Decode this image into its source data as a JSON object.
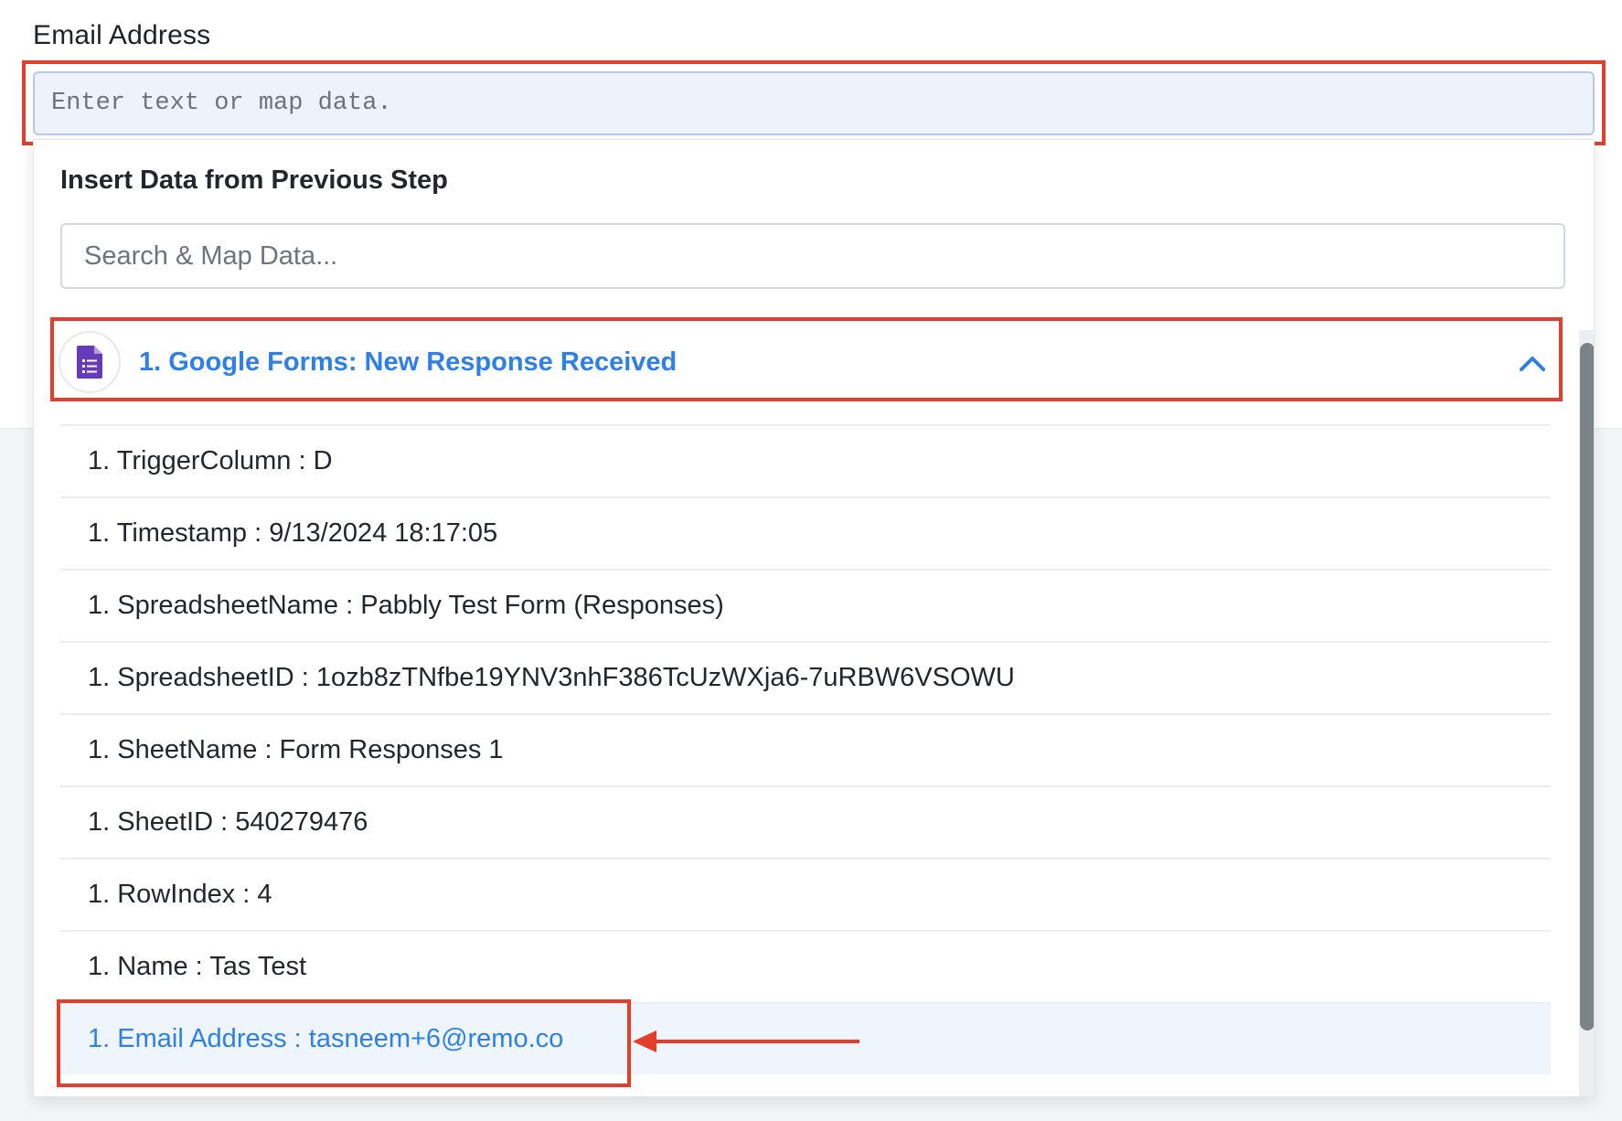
{
  "field": {
    "label": "Email Address",
    "placeholder": "Enter text or map data."
  },
  "dropdown": {
    "title": "Insert Data from Previous Step",
    "search_placeholder": "Search & Map Data...",
    "step": {
      "title": "1. Google Forms: New Response Received",
      "icon": "google-forms-icon",
      "expanded": true
    },
    "items": [
      {
        "label": "1. TriggerColumn : D"
      },
      {
        "label": "1. Timestamp : 9/13/2024 18:17:05"
      },
      {
        "label": "1. SpreadsheetName : Pabbly Test Form (Responses)"
      },
      {
        "label": "1. SpreadsheetID : 1ozb8zTNfbe19YNV3nhF386TcUzWXja6-7uRBW6VSOWU"
      },
      {
        "label": "1. SheetName : Form Responses 1"
      },
      {
        "label": "1. SheetID : 540279476"
      },
      {
        "label": "1. RowIndex : 4"
      },
      {
        "label": "1. Name : Tas Test"
      },
      {
        "label": "1. Email Address : tasneem+6@remo.co",
        "selected": true
      }
    ]
  },
  "colors": {
    "accent": "#2f80e6",
    "highlight_red": "#e23e2b",
    "selected_bg": "#eef5fd",
    "forms_purple": "#673ab7"
  }
}
